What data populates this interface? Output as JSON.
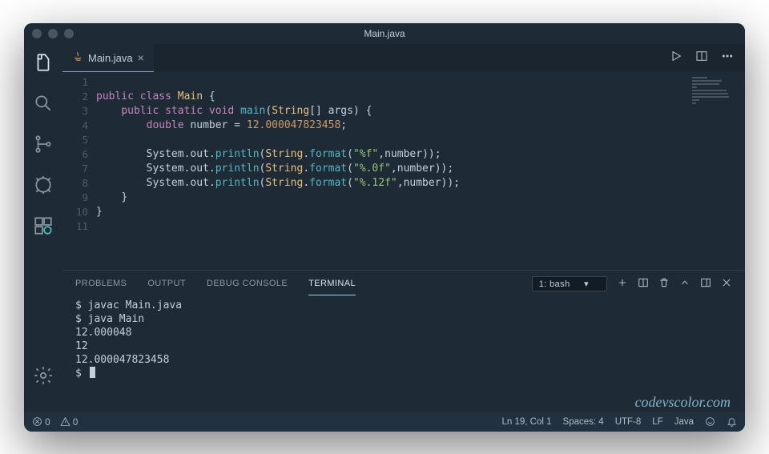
{
  "title": "Main.java",
  "tabs": [
    {
      "label": "Main.java",
      "icon": "java-icon"
    }
  ],
  "editor": {
    "line_numbers": [
      "1",
      "2",
      "3",
      "4",
      "5",
      "6",
      "7",
      "8",
      "9",
      "10",
      "11"
    ],
    "code": {
      "l2_public": "public",
      "l2_class": "class",
      "l2_name": "Main",
      "l3_public": "public",
      "l3_static": "static",
      "l3_void": "void",
      "l3_main": "main",
      "l3_string": "String",
      "l3_args": "args",
      "l4_double": "double",
      "l4_number": "number",
      "l4_val": "12.000047823458",
      "sys": "System",
      "out": "out",
      "println": "println",
      "stringcls": "String",
      "format": "format",
      "fmt1": "\"%f\"",
      "fmt2": "\"%.0f\"",
      "fmt3": "\"%.12f\"",
      "numarg": "number"
    }
  },
  "panel": {
    "tabs": {
      "problems": "PROBLEMS",
      "output": "OUTPUT",
      "debug": "DEBUG CONSOLE",
      "terminal": "TERMINAL"
    },
    "terminal_name": "1: bash",
    "terminal_lines": [
      "$ javac Main.java",
      "$ java Main",
      "12.000048",
      "12",
      "12.000047823458",
      "$ "
    ],
    "watermark": "codevscolor.com"
  },
  "statusbar": {
    "errors": "0",
    "warnings": "0",
    "lncol": "Ln 19, Col 1",
    "spaces": "Spaces: 4",
    "encoding": "UTF-8",
    "eol": "LF",
    "lang": "Java"
  }
}
